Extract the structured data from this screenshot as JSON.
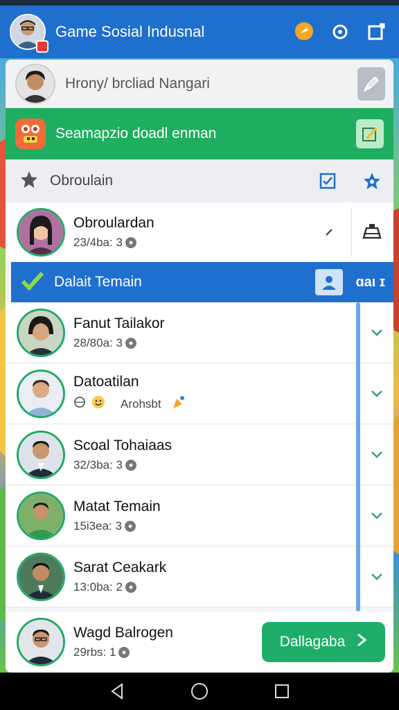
{
  "app": {
    "title": "Game Sosial Indusnal"
  },
  "profile": {
    "name": "Hrony/ brcliad Nangari"
  },
  "promo": {
    "text": "Seamapzio doadl enman"
  },
  "section": {
    "label": "Obroulain"
  },
  "pinned_friend": {
    "name": "Obroulardan",
    "sub": "23/4ba: 3"
  },
  "friend_list": {
    "title": "Dalait Temain",
    "count": "ɑаι ɪ",
    "items": [
      {
        "name": "Fanut Tailakor",
        "sub": "28/80a: 3"
      },
      {
        "name": "Datoatilan",
        "sub": "Arohsbt"
      },
      {
        "name": "Scoal Tohaiaas",
        "sub": "32/3ba: 3"
      },
      {
        "name": "Matat Temain",
        "sub": "15i3ea: 3"
      },
      {
        "name": "Sarat Ceakark",
        "sub": "13:0ba: 2"
      }
    ]
  },
  "bottom_friend": {
    "name": "Wagd Balrogen",
    "sub": "29rbs: 1"
  },
  "cta": {
    "label": "Dallagaba"
  },
  "colors": {
    "primary_blue": "#1f6fce",
    "green": "#1fae5f",
    "avatar_ring": "#22a866"
  }
}
